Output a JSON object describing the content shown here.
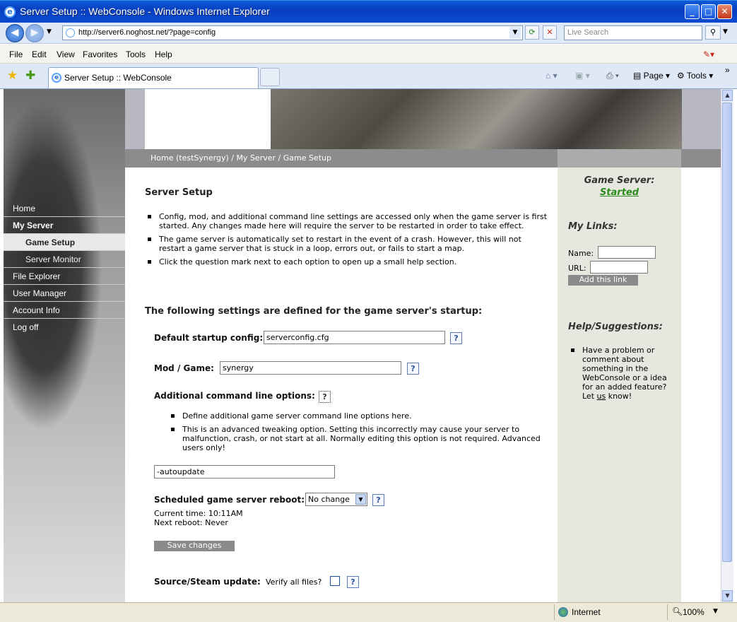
{
  "window": {
    "title": "Server Setup :: WebConsole - Windows Internet Explorer"
  },
  "address": {
    "url": "http://server6.noghost.net/?page=config",
    "search_placeholder": "Live Search"
  },
  "menu": [
    "File",
    "Edit",
    "View",
    "Favorites",
    "Tools",
    "Help"
  ],
  "tab": {
    "title": "Server Setup :: WebConsole"
  },
  "toolbar": {
    "page": "Page",
    "tools": "Tools"
  },
  "breadcrumb": "Home (testSynergy) / My Server / Game Setup",
  "sidebar": {
    "items": [
      {
        "label": "Home"
      },
      {
        "label": "My Server"
      },
      {
        "label": "Game Setup"
      },
      {
        "label": "Server Monitor"
      },
      {
        "label": "File Explorer"
      },
      {
        "label": "User Manager"
      },
      {
        "label": "Account Info"
      },
      {
        "label": "Log off"
      }
    ]
  },
  "main": {
    "title": "Server Setup",
    "notes": [
      "Config, mod, and additional command line settings are accessed only when the game server is first started. Any changes made here will require the server to be restarted in order to take effect.",
      "The game server is automatically set to restart in the event of a crash. However, this will not restart a game server that is stuck in a loop, errors out, or fails to start a map.",
      "Click the question mark next to each option to open up a small help section."
    ],
    "settings_heading": "The following settings are defined for the game server's startup:",
    "startup_config_label": "Default startup config:",
    "startup_config_value": "serverconfig.cfg",
    "mod_label": "Mod / Game:",
    "mod_value": "synergy",
    "cmdline_label": "Additional command line options:",
    "cmdline_notes": [
      "Define additional game server command line options here.",
      "This is an advanced tweaking option. Setting this incorrectly may cause your server to malfunction, crash, or not start at all. Normally editing this option is not required. Advanced users only!"
    ],
    "cmdline_value": "-autoupdate",
    "reboot_label": "Scheduled game server reboot:",
    "reboot_value": "No change",
    "current_time": "Current time: 10:11AM",
    "next_reboot": "Next reboot: Never",
    "save_label": "Save changes",
    "steam_label": "Source/Steam update:",
    "verify_label": "Verify all files?",
    "help_glyph": "?"
  },
  "right": {
    "game_server_label": "Game Server:",
    "game_server_status": "Started",
    "links_heading": "My Links:",
    "name_label": "Name:",
    "url_label": "URL:",
    "add_link_label": "Add this link",
    "help_heading": "Help/Suggestions:",
    "help_text_pre": "Have a problem or comment about something in the WebConsole or a idea for an added feature? Let ",
    "help_link": "us",
    "help_text_post": " know!"
  },
  "status": {
    "zone": "Internet",
    "zoom": "100%"
  },
  "colors": {
    "titlebar": "#0a4ad0",
    "status_started": "#2a8a1a",
    "sidebar_bg": "#6a6a6a"
  }
}
